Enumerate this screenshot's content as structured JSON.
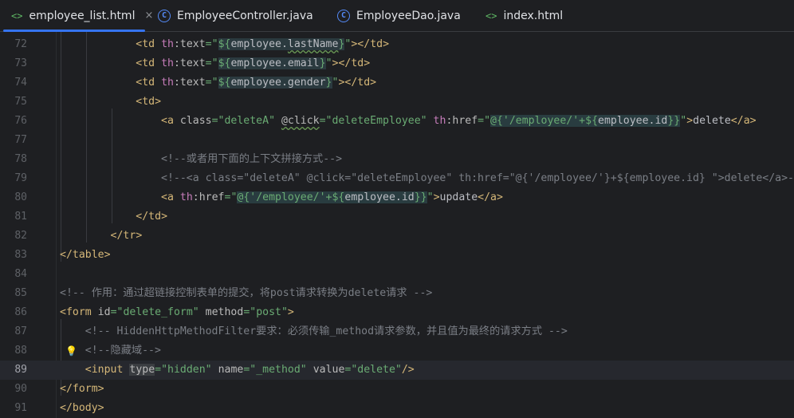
{
  "tabs": [
    {
      "label": "employee_list.html",
      "kind": "html",
      "active": true,
      "closable": true
    },
    {
      "label": "EmployeeController.java",
      "kind": "java",
      "active": false,
      "closable": false
    },
    {
      "label": "EmployeeDao.java",
      "kind": "java",
      "active": false,
      "closable": false
    },
    {
      "label": "index.html",
      "kind": "html",
      "active": false,
      "closable": false
    }
  ],
  "icons": {
    "html": "<>",
    "java": "C",
    "close": "×",
    "bulb": "lightbulb-icon"
  },
  "current_line": 89,
  "lines": [
    {
      "n": "72",
      "html": "            <span class='br'>&lt;</span><span class='tag'>td</span> <span class='ns'>th</span><span class='attr'>:text</span><span class='val'>=\"</span><span class='hl'><span class='dol'>${</span>employee.<span class='sq'>lastName</span><span class='dol'>}</span></span><span class='val'>\"</span><span class='br'>&gt;&lt;/</span><span class='tag'>td</span><span class='br'>&gt;</span>"
    },
    {
      "n": "73",
      "html": "            <span class='br'>&lt;</span><span class='tag'>td</span> <span class='ns'>th</span><span class='attr'>:text</span><span class='val'>=\"</span><span class='hl'><span class='dol'>${</span>employee.email<span class='dol'>}</span></span><span class='val'>\"</span><span class='br'>&gt;&lt;/</span><span class='tag'>td</span><span class='br'>&gt;</span>"
    },
    {
      "n": "74",
      "html": "            <span class='br'>&lt;</span><span class='tag'>td</span> <span class='ns'>th</span><span class='attr'>:text</span><span class='val'>=\"</span><span class='hl'><span class='dol'>${</span>employee.gender<span class='dol'>}</span></span><span class='val'>\"</span><span class='br'>&gt;&lt;/</span><span class='tag'>td</span><span class='br'>&gt;</span>"
    },
    {
      "n": "75",
      "html": "            <span class='br'>&lt;</span><span class='tag'>td</span><span class='br'>&gt;</span>"
    },
    {
      "n": "76",
      "html": "                <span class='br'>&lt;</span><span class='tag'>a</span> <span class='attr'>class</span><span class='val'>=\"deleteA\"</span> <span class='attr sq'>@click</span><span class='val'>=\"deleteEmployee\"</span> <span class='ns'>th</span><span class='attr'>:href</span><span class='val'>=\"</span><span class='elv'><span class='val'>@{'/employee/'+</span><span class='dol'>${</span><span class='plain'>employee.id</span><span class='dol'>}}</span></span><span class='val'>\"</span><span class='br'>&gt;</span><span class='plain'>delete</span><span class='br'>&lt;/</span><span class='tag'>a</span><span class='br'>&gt;</span>"
    },
    {
      "n": "77",
      "html": ""
    },
    {
      "n": "78",
      "html": "                <span class='cmt'>&lt;!--或者用下面的上下文拼接方式--&gt;</span>"
    },
    {
      "n": "79",
      "html": "                <span class='cmt'>&lt;!--&lt;a class=\"deleteA\" @click=\"deleteEmployee\" th:href=\"@{'/employee/'}+${employee.id} \"&gt;delete&lt;/a&gt;--&gt;</span>"
    },
    {
      "n": "80",
      "html": "                <span class='br'>&lt;</span><span class='tag'>a</span> <span class='ns'>th</span><span class='attr'>:href</span><span class='val'>=\"</span><span class='elv'><span class='val'>@{'/employee/'+</span><span class='dol'>${</span><span class='plain'>employee.id</span><span class='dol'>}}</span></span><span class='val'>\"</span><span class='br'>&gt;</span><span class='plain'>update</span><span class='br'>&lt;/</span><span class='tag'>a</span><span class='br'>&gt;</span>"
    },
    {
      "n": "81",
      "html": "            <span class='br'>&lt;/</span><span class='tag'>td</span><span class='br'>&gt;</span>"
    },
    {
      "n": "82",
      "html": "        <span class='br'>&lt;/</span><span class='tag'>tr</span><span class='br'>&gt;</span>"
    },
    {
      "n": "83",
      "html": "<span class='br'>&lt;/</span><span class='tag'>table</span><span class='br'>&gt;</span>"
    },
    {
      "n": "84",
      "html": ""
    },
    {
      "n": "85",
      "html": "<span class='cmt'>&lt;!-- 作用：通过超链接控制表单的提交，将post请求转换为delete请求 --&gt;</span>"
    },
    {
      "n": "86",
      "html": "<span class='br'>&lt;</span><span class='tag'>form</span> <span class='attr'>id</span><span class='val'>=\"delete_form\"</span> <span class='attr'>method</span><span class='val'>=\"post\"</span><span class='br'>&gt;</span>"
    },
    {
      "n": "87",
      "html": "    <span class='cmt'>&lt;!-- HiddenHttpMethodFilter要求：必须传输_method请求参数，并且值为最终的请求方式 --&gt;</span>"
    },
    {
      "n": "88",
      "html": "    <span class='cmt'>&lt;!--隐藏域--&gt;</span>"
    },
    {
      "n": "89",
      "html": "    <span class='br'>&lt;</span><span class='tag'>input</span> <span class='attr warnbg'>type</span><span class='val'>=\"hidden\"</span> <span class='attr'>name</span><span class='val'>=\"_method\"</span> <span class='attr'>value</span><span class='val'>=\"delete\"</span><span class='br'>/&gt;</span>"
    },
    {
      "n": "90",
      "html": "<span class='br'>&lt;/</span><span class='tag'>form</span><span class='br'>&gt;</span>"
    },
    {
      "n": "91",
      "html": "<span class='br'>&lt;/</span><span class='tag'>body</span><span class='br'>&gt;</span>"
    }
  ]
}
